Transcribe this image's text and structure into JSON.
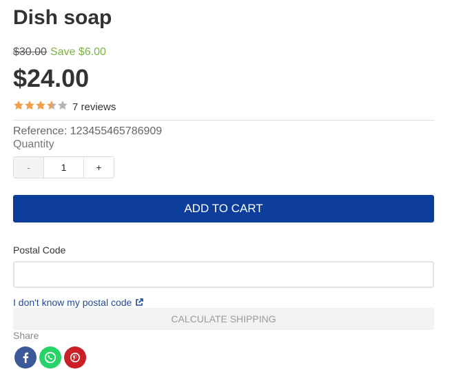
{
  "product": {
    "title": "Dish soap",
    "old_price": "$30.00",
    "save_text": "Save $6.00",
    "price": "$24.00",
    "rating": 3.5,
    "rating_max": 5,
    "reviews_text": "7 reviews",
    "reference": "Reference: 123455465786909"
  },
  "quantity": {
    "label": "Quantity",
    "minus_label": "-",
    "value": "1",
    "plus_label": "+"
  },
  "cart": {
    "add_label": "ADD TO CART"
  },
  "shipping": {
    "postal_label": "Postal Code",
    "postal_value": "",
    "postal_link_text": "I don't know my postal code",
    "calc_label": "CALCULATE SHIPPING"
  },
  "share": {
    "label": "Share",
    "icons": [
      "facebook-icon",
      "whatsapp-icon",
      "pinterest-icon"
    ]
  },
  "colors": {
    "accent": "#0c3d9c",
    "save_green": "#7cb342",
    "star": "#f0a04b",
    "facebook": "#3b5998",
    "whatsapp": "#25d366",
    "pinterest": "#cb2027"
  }
}
